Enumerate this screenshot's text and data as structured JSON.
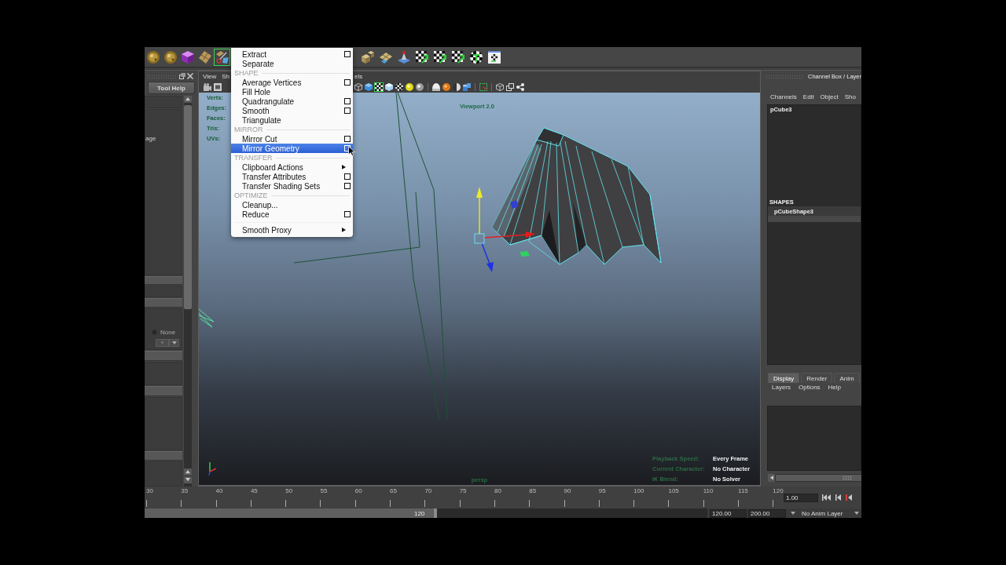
{
  "shelf": {
    "left": [
      {
        "selected": false
      },
      {
        "selected": false
      },
      {
        "selected": false
      },
      {
        "selected": false
      },
      {
        "selected": true
      }
    ],
    "right": [
      {
        "selected": false
      },
      {
        "selected": false
      },
      {
        "selected": false
      },
      {
        "selected": false
      },
      {
        "selected": false
      },
      {
        "selected": false
      },
      {
        "selected": false
      },
      {
        "selected": false
      }
    ]
  },
  "menu": {
    "entries": [
      {
        "kind": "item",
        "label": "Extract",
        "option_box": true,
        "submenu": false,
        "selected": false
      },
      {
        "kind": "item",
        "label": "Separate",
        "option_box": false,
        "submenu": false,
        "selected": false
      },
      {
        "kind": "section",
        "label": "SHAPE"
      },
      {
        "kind": "item",
        "label": "Average Vertices",
        "option_box": true,
        "submenu": false,
        "selected": false
      },
      {
        "kind": "item",
        "label": "Fill Hole",
        "option_box": false,
        "submenu": false,
        "selected": false
      },
      {
        "kind": "item",
        "label": "Quadrangulate",
        "option_box": true,
        "submenu": false,
        "selected": false
      },
      {
        "kind": "item",
        "label": "Smooth",
        "option_box": true,
        "submenu": false,
        "selected": false
      },
      {
        "kind": "item",
        "label": "Triangulate",
        "option_box": false,
        "submenu": false,
        "selected": false
      },
      {
        "kind": "section",
        "label": "MIRROR"
      },
      {
        "kind": "item",
        "label": "Mirror Cut",
        "option_box": true,
        "submenu": false,
        "selected": false
      },
      {
        "kind": "item",
        "label": "Mirror Geometry",
        "option_box": true,
        "submenu": false,
        "selected": true
      },
      {
        "kind": "section",
        "label": "TRANSFER"
      },
      {
        "kind": "item",
        "label": "Clipboard Actions",
        "option_box": false,
        "submenu": true,
        "selected": false
      },
      {
        "kind": "item",
        "label": "Transfer Attributes",
        "option_box": true,
        "submenu": false,
        "selected": false
      },
      {
        "kind": "item",
        "label": "Transfer Shading Sets",
        "option_box": true,
        "submenu": false,
        "selected": false
      },
      {
        "kind": "section",
        "label": "OPTIMIZE"
      },
      {
        "kind": "item",
        "label": "Cleanup...",
        "option_box": false,
        "submenu": false,
        "selected": false
      },
      {
        "kind": "item",
        "label": "Reduce",
        "option_box": true,
        "submenu": false,
        "selected": false
      },
      {
        "kind": "separator"
      },
      {
        "kind": "item",
        "label": "Smooth Proxy",
        "option_box": false,
        "submenu": true,
        "selected": false
      }
    ]
  },
  "tool_settings": {
    "header_button": "Tool Help",
    "text_fragment": "age",
    "radio": {
      "label": "None",
      "checked": false
    },
    "add_button": "+"
  },
  "viewport_panel": {
    "menu_left": [
      "View",
      "Sh"
    ],
    "menu_right": [
      "els"
    ],
    "toolbar_left": [
      {
        "selected": false
      },
      {
        "selected": false
      }
    ],
    "toolbar_right": [
      [
        {
          "selected": false
        },
        {
          "selected": false
        },
        {
          "selected": true
        },
        {
          "selected": false
        },
        {
          "selected": false
        },
        {
          "selected": false
        },
        {
          "selected": false
        }
      ],
      [
        {
          "selected": false
        },
        {
          "selected": false
        },
        {
          "selected": false
        },
        {
          "selected": false
        }
      ],
      [
        {
          "selected": false
        }
      ],
      [
        {
          "selected": false
        },
        {
          "selected": false
        },
        {
          "selected": false
        }
      ]
    ],
    "hud": {
      "stats": [
        "Verts:",
        "Edges:",
        "Faces:",
        "Tris:",
        "UVs:"
      ],
      "renderer": "Viewport 2.0",
      "info": [
        {
          "label": "Playback Speed:",
          "value": "Every Frame"
        },
        {
          "label": "Current Character:",
          "value": "No Character"
        },
        {
          "label": "IK Blend:",
          "value": "No Solver"
        }
      ],
      "camera": "persp"
    }
  },
  "channel_box": {
    "title": "Channel Box / Layer",
    "menus": [
      "Channels",
      "Edit",
      "Object",
      "Sho"
    ],
    "object": "pCube3",
    "shapes_heading": "SHAPES",
    "shapes": [
      "pCubeShape3"
    ]
  },
  "layer_editor": {
    "tabs": [
      {
        "label": "Display",
        "selected": true
      },
      {
        "label": "Render",
        "selected": false
      },
      {
        "label": "Anim",
        "selected": false
      }
    ],
    "menus": [
      "Layers",
      "Options",
      "Help"
    ]
  },
  "time_slider": {
    "frames": [
      "30",
      "35",
      "40",
      "45",
      "50",
      "55",
      "60",
      "65",
      "70",
      "75",
      "80",
      "85",
      "90",
      "95",
      "100",
      "105",
      "110",
      "115",
      "120"
    ],
    "current_frame": "1.00"
  },
  "range_slider": {
    "level": 0.52,
    "bar_label": "120",
    "playback_end": "120.00",
    "animation_end": "200.00",
    "anim_layer": "No Anim Layer"
  }
}
